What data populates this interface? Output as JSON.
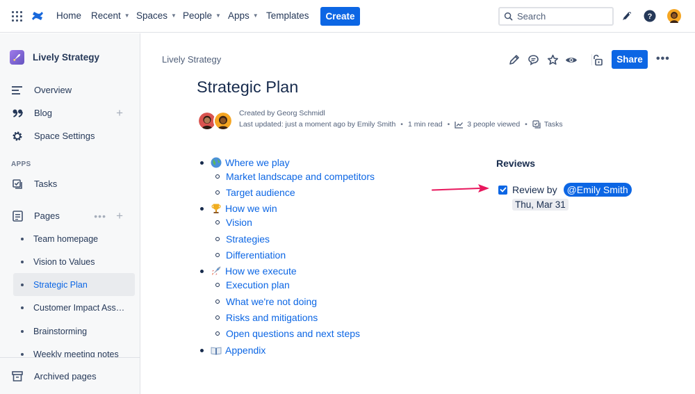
{
  "topnav": {
    "items": [
      {
        "label": "Home",
        "dropdown": false
      },
      {
        "label": "Recent",
        "dropdown": true
      },
      {
        "label": "Spaces",
        "dropdown": true
      },
      {
        "label": "People",
        "dropdown": true
      },
      {
        "label": "Apps",
        "dropdown": true
      },
      {
        "label": "Templates",
        "dropdown": false
      }
    ],
    "create_label": "Create",
    "search_placeholder": "Search",
    "icons": [
      "app-switcher-icon",
      "confluence-logo-icon",
      "search-icon",
      "notifications-icon",
      "help-icon",
      "user-avatar"
    ]
  },
  "sidebar": {
    "space_name": "Lively Strategy",
    "nav": [
      {
        "label": "Overview",
        "icon": "overview-icon"
      },
      {
        "label": "Blog",
        "icon": "blog-quote-icon"
      },
      {
        "label": "Space Settings",
        "icon": "gear-icon"
      }
    ],
    "apps_label": "APPS",
    "apps": [
      {
        "label": "Tasks",
        "icon": "tasks-icon"
      }
    ],
    "pages_label": "Pages",
    "pages": [
      {
        "label": "Team homepage",
        "selected": false
      },
      {
        "label": "Vision to Values",
        "selected": false
      },
      {
        "label": "Strategic Plan",
        "selected": true
      },
      {
        "label": "Customer Impact Ass…",
        "selected": false
      },
      {
        "label": "Brainstorming",
        "selected": false
      },
      {
        "label": "Weekly meeting notes",
        "selected": false
      }
    ],
    "archived_label": "Archived pages"
  },
  "main": {
    "breadcrumb": "Lively Strategy",
    "share_label": "Share",
    "title": "Strategic Plan",
    "byline": {
      "created_by": "Created by Georg Schmidl",
      "last_updated": "Last updated: just a moment ago by Emily Smith",
      "read_time": "1 min read",
      "viewed": "3 people viewed",
      "tasks": "Tasks"
    },
    "outline": [
      {
        "label": "Where we play",
        "level": 1,
        "emoji": "globe"
      },
      {
        "label": "Market landscape and competitors",
        "level": 2
      },
      {
        "label": "Target audience",
        "level": 2
      },
      {
        "label": "How we win",
        "level": 1,
        "emoji": "trophy"
      },
      {
        "label": "Vision",
        "level": 2
      },
      {
        "label": "Strategies",
        "level": 2
      },
      {
        "label": "Differentiation",
        "level": 2
      },
      {
        "label": "How we execute",
        "level": 1,
        "emoji": "rocket"
      },
      {
        "label": "Execution plan",
        "level": 2
      },
      {
        "label": "What we're not doing",
        "level": 2
      },
      {
        "label": "Risks and mitigations",
        "level": 2
      },
      {
        "label": "Open questions and next steps",
        "level": 2
      },
      {
        "label": "Appendix",
        "level": 1,
        "emoji": "book"
      }
    ],
    "reviews": {
      "heading": "Reviews",
      "task_text": "Review by",
      "mention": "@Emily Smith",
      "date": "Thu, Mar 31",
      "checked": true
    }
  },
  "colors": {
    "brand_blue": "#0c66e4",
    "text_primary": "#172b4d",
    "text_subtle": "#505f79",
    "annotation_arrow": "#e8175d"
  }
}
